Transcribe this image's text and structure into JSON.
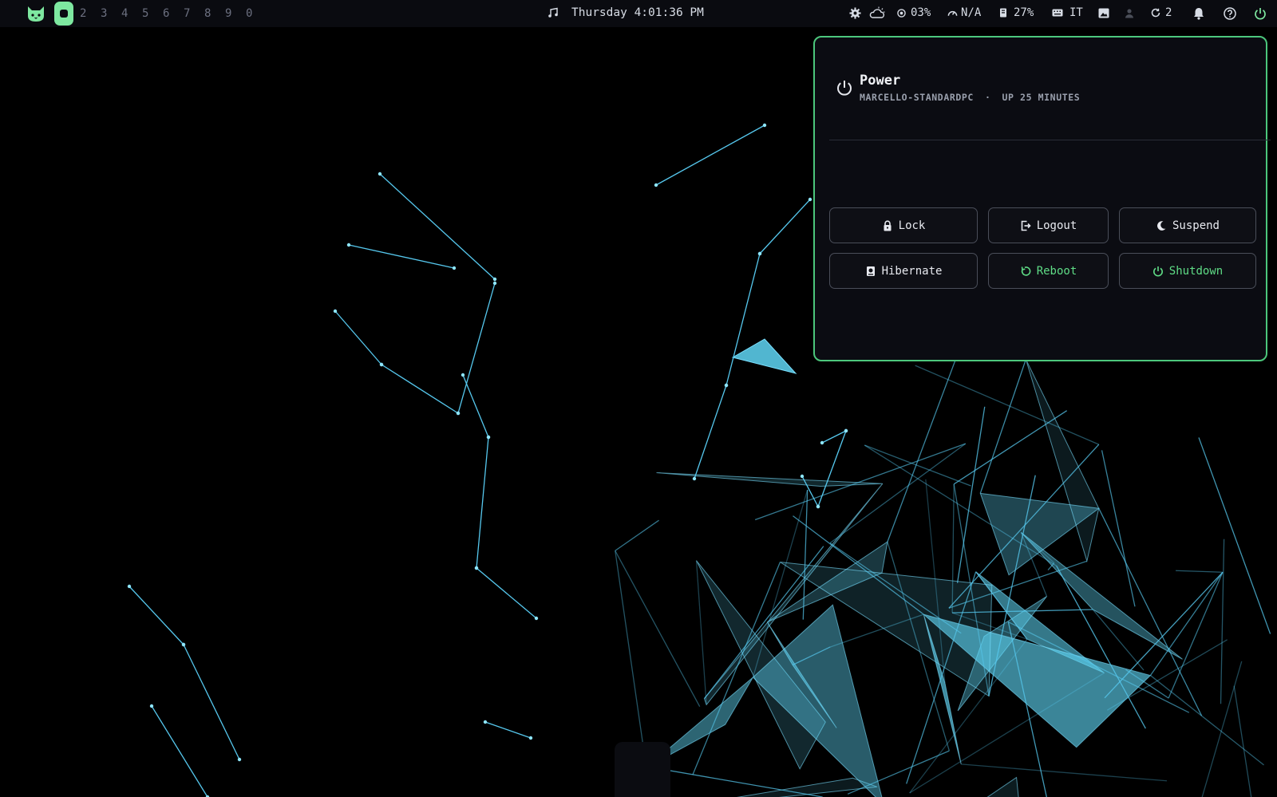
{
  "topbar": {
    "workspaces": [
      "2",
      "3",
      "4",
      "5",
      "6",
      "7",
      "8",
      "9",
      "0"
    ],
    "clock": "Thursday 4:01:36 PM",
    "cpu": "03%",
    "speed": "N/A",
    "memory": "27%",
    "keyboard_layout": "IT",
    "updates": "2",
    "accent": "#7ee8a0"
  },
  "power": {
    "title": "Power",
    "hostname": "MARCELLO-STANDARDPC",
    "separator": "·",
    "uptime": "UP 25 MINUTES",
    "buttons": {
      "lock": "Lock",
      "logout": "Logout",
      "suspend": "Suspend",
      "hibernate": "Hibernate",
      "reboot": "Reboot",
      "shutdown": "Shutdown"
    },
    "border_color": "#4cc77c",
    "accent_text": "#5fdc86"
  }
}
